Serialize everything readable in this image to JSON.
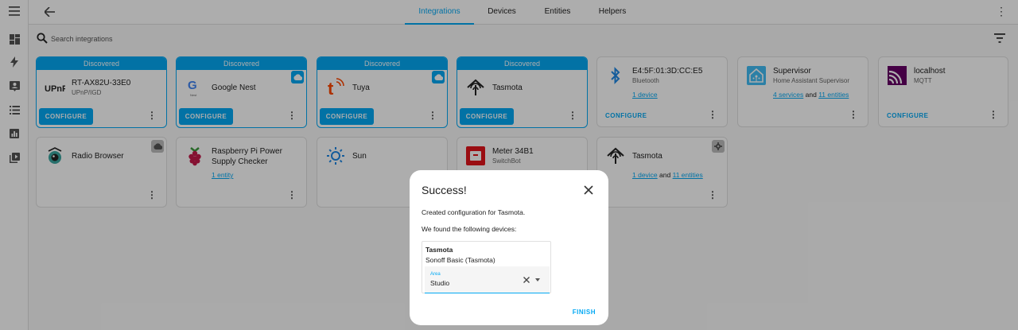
{
  "nav": {
    "tabs": [
      {
        "label": "Integrations",
        "active": true
      },
      {
        "label": "Devices"
      },
      {
        "label": "Entities"
      },
      {
        "label": "Helpers"
      }
    ]
  },
  "search": {
    "placeholder": "Search integrations"
  },
  "colors": {
    "accent": "#03a9f4",
    "overlay": "rgba(0,0,0,0.32)"
  },
  "discovered_label": "Discovered",
  "configure_label": "CONFIGURE",
  "cards": [
    {
      "title": "RT-AX82U-33E0",
      "subtitle": "UPnP/IGD",
      "icon": "upnp-logo"
    },
    {
      "title": "Google Nest",
      "icon": "google-nest-logo",
      "badge": "cloud-icon"
    },
    {
      "title": "Tuya",
      "icon": "tuya-logo",
      "badge": "cloud-icon"
    },
    {
      "title": "Tasmota",
      "icon": "tasmota-logo"
    },
    {
      "title": "E4:5F:01:3D:CC:E5",
      "subtitle": "Bluetooth",
      "link1": "1 device",
      "icon": "bluetooth-icon"
    },
    {
      "title": "Supervisor",
      "subtitle": "Home Assistant Supervisor",
      "link1": "4 services",
      "joiner": "and",
      "link2": "11 entities",
      "icon": "home-assistant-logo"
    },
    {
      "title": "localhost",
      "subtitle": "MQTT",
      "icon": "mqtt-logo"
    },
    {
      "title": "Radio Browser",
      "icon": "radio-browser-logo",
      "badge": "cloud-icon"
    },
    {
      "title": "Raspberry Pi Power Supply Checker",
      "link1": "1 entity",
      "icon": "raspberry-pi-logo"
    },
    {
      "title": "Sun",
      "icon": "sun-icon"
    },
    {
      "title": "Meter 34B1",
      "subtitle": "SwitchBot",
      "icon": "switchbot-logo"
    },
    {
      "title": "Tasmota",
      "link1": "1 device",
      "joiner": "and",
      "link2": "11 entities",
      "icon": "tasmota-logo",
      "badge": "custom-integration-icon"
    }
  ],
  "dialog": {
    "title": "Success!",
    "created_text": "Created configuration for Tasmota.",
    "found_text": "We found the following devices:",
    "device": {
      "name": "Tasmota",
      "model": "Sonoff Basic (Tasmota)",
      "area_label": "Area",
      "area_value": "Studio"
    },
    "finish_label": "FINISH"
  }
}
